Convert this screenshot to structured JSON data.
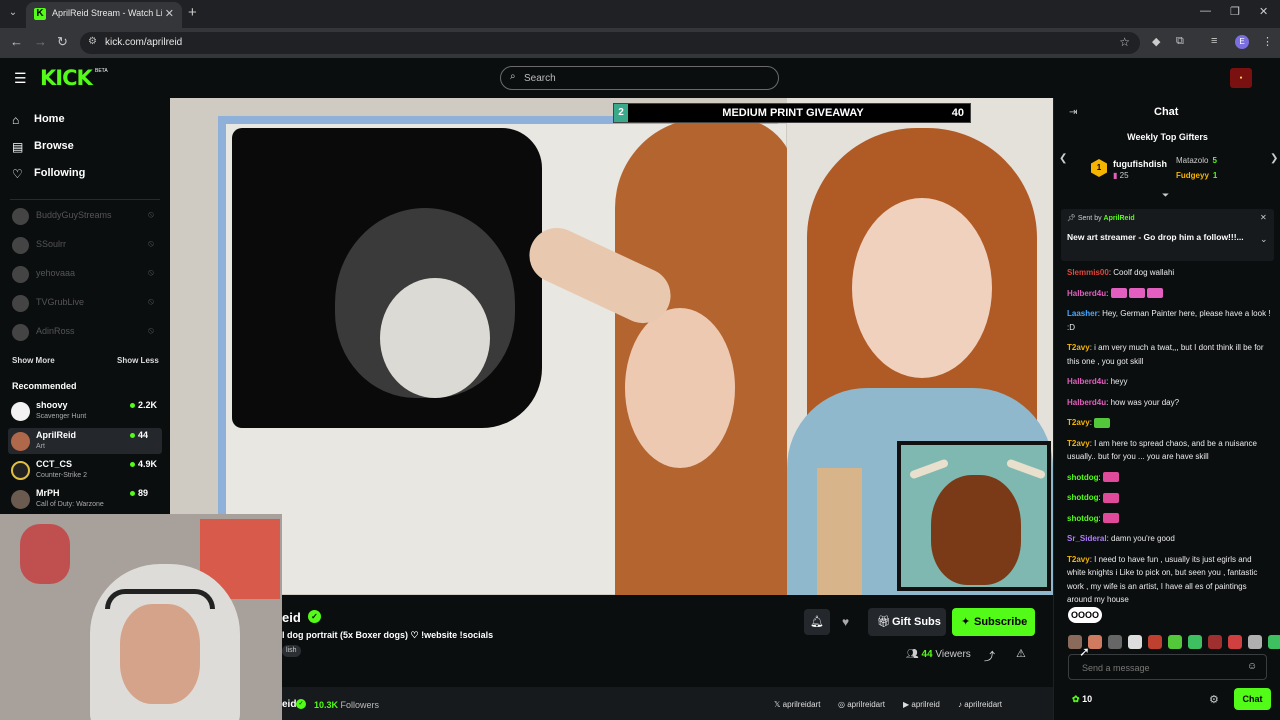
{
  "browser": {
    "tab_title": "AprilReid Stream - Watch Live o",
    "url": "kick.com/aprilreid",
    "new_tab": "+",
    "close_tab": "✕",
    "profile_initial": "E"
  },
  "header": {
    "logo": "KICK",
    "beta": "BETA",
    "search_placeholder": "Search",
    "accent": "#53fc18"
  },
  "sidebar": {
    "nav": [
      {
        "label": "Home",
        "icon": "home-icon"
      },
      {
        "label": "Browse",
        "icon": "browse-icon"
      },
      {
        "label": "Following",
        "icon": "heart-icon"
      }
    ],
    "followed": [
      {
        "name": "BuddyGuyStreams"
      },
      {
        "name": "SSoulrr"
      },
      {
        "name": "yehovaaa"
      },
      {
        "name": "TVGrubLive"
      },
      {
        "name": "AdinRoss"
      }
    ],
    "show_more": "Show More",
    "show_less": "Show Less",
    "recommended_title": "Recommended",
    "recommended": [
      {
        "name": "shoovy",
        "category": "Scavenger Hunt",
        "viewers": "2.2K"
      },
      {
        "name": "AprilReid",
        "category": "Art",
        "viewers": "44"
      },
      {
        "name": "CCT_CS",
        "category": "Counter-Strike 2",
        "viewers": "4.9K"
      },
      {
        "name": "MrPH",
        "category": "Call of Duty: Warzone",
        "viewers": "89"
      }
    ]
  },
  "video": {
    "giveaway_left": "2",
    "giveaway_title": "MEDIUM PRINT GIVEAWAY",
    "giveaway_right": "40"
  },
  "stream": {
    "name_partial": "eid",
    "title_partial": "l dog portrait (5x Boxer dogs) ♡ !website !socials",
    "language_partial": "lish",
    "gift_label": "Gift Subs",
    "subscribe_label": "Subscribe",
    "viewers_count": "44",
    "viewers_label": "Viewers",
    "bottom_name_partial": "eid",
    "followers_count": "10.3K",
    "followers_label": "Followers",
    "socials": [
      "aprilreidart",
      "aprilreidart",
      "aprilreid",
      "aprilreidart"
    ]
  },
  "chat": {
    "title": "Chat",
    "gifters_title": "Weekly Top Gifters",
    "gifters": [
      {
        "rank": "1",
        "name": "fugufishdish",
        "count": "25"
      },
      {
        "name": "Matazolo",
        "count": "5"
      },
      {
        "name": "Fudgeyy",
        "count": "1"
      }
    ],
    "pinned_by_label": "Sent by",
    "pinned_by": "AprilReid",
    "pinned_msg": "New art streamer - Go drop him a follow!!!...",
    "messages": [
      {
        "user": "Slemmis00",
        "color": "#e0463a",
        "text": "Coolf dog wallahi"
      },
      {
        "user": "Halberd4u",
        "color": "#e25fbf",
        "text": "",
        "emotes": [
          "#e25fbf",
          "#e25fbf",
          "#e25fbf"
        ]
      },
      {
        "user": "Laasher",
        "color": "#4aa8ff",
        "text": "Hey, German Painter here, please have a look ! :D"
      },
      {
        "user": "T2avy",
        "color": "#f5b400",
        "text": "i am very much a twat,,, but I dont think ill be for this one , you got skill"
      },
      {
        "user": "Halberd4u",
        "color": "#e25fbf",
        "text": "heyy"
      },
      {
        "user": "Halberd4u",
        "color": "#e25fbf",
        "text": "how was your day?"
      },
      {
        "user": "T2avy",
        "color": "#f5b400",
        "text": "",
        "emotes": [
          "#53c83a"
        ]
      },
      {
        "user": "T2avy",
        "color": "#f5b400",
        "text": "I am here to spread chaos, and be a nuisance usually.. but for you ... you are have skill"
      },
      {
        "user": "shotdog",
        "color": "#53fc18",
        "text": "",
        "emotes": [
          "#e04a9a"
        ]
      },
      {
        "user": "shotdog",
        "color": "#53fc18",
        "text": "",
        "emotes": [
          "#e04a9a"
        ]
      },
      {
        "user": "shotdog",
        "color": "#53fc18",
        "text": "",
        "emotes": [
          "#e04a9a"
        ]
      },
      {
        "user": "Sr_Sideral",
        "color": "#b07cff",
        "text": "damn you're good"
      },
      {
        "user": "T2avy",
        "color": "#f5b400",
        "text": "I need to have fun , usually its just egirls and white knights i Like to pick on, but seen you , fantastic work , my wife is an artist, I have all es of paintings around my house"
      }
    ],
    "hover_emote_label": "OOOO",
    "emote_colors": [
      "#8a6a5a",
      "#d07a60",
      "#666",
      "#ddd",
      "#c04030",
      "#53c83a",
      "#3fc060",
      "#a03030",
      "#d04040",
      "#b0b0b0",
      "#3fc060"
    ],
    "input_placeholder": "Send a message",
    "points": "10",
    "send_label": "Chat"
  }
}
